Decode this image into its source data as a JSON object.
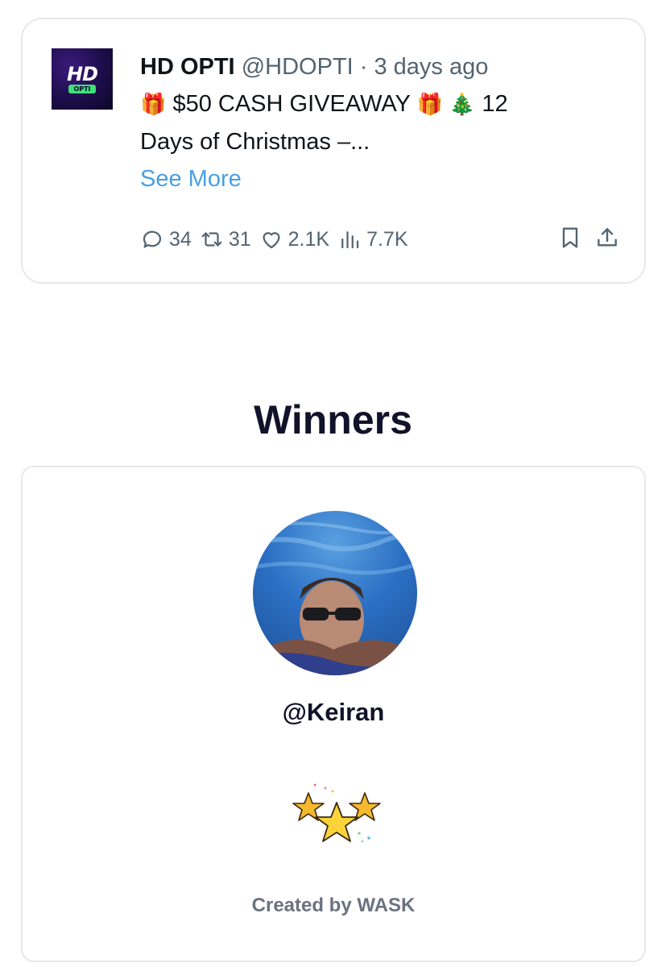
{
  "tweet": {
    "author_name": "HD OPTI",
    "author_handle": "@HDOPTI",
    "separator": "·",
    "time": "3 days ago",
    "logo": {
      "main": "HD",
      "badge": "OPTI"
    },
    "text_line1": "$50 CASH GIVEAWAY",
    "text_tail": "12",
    "text_line2": "Days of Christmas –...",
    "emojis": [
      "gift-icon",
      "gift-icon",
      "christmas-tree-icon"
    ],
    "see_more": "See More",
    "stats": {
      "replies": "34",
      "retweets": "31",
      "likes": "2.1K",
      "views": "7.7K"
    },
    "colors": {
      "link": "#4a9fe3",
      "muted": "#536471"
    }
  },
  "winners": {
    "heading": "Winners",
    "winner_handle": "@Keiran",
    "credit": "Created by WASK"
  }
}
